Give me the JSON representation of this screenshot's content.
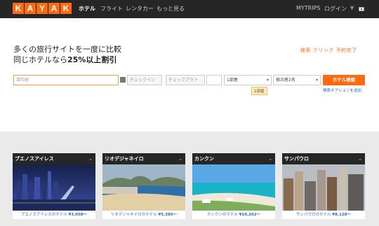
{
  "header": {
    "logo_letters": [
      "K",
      "A",
      "Y",
      "A",
      "K"
    ],
    "nav": [
      "ホテル",
      "フライト",
      "レンタカー",
      "もっと見る"
    ],
    "right": [
      "MYTRIPS",
      "ログイン",
      "¥"
    ]
  },
  "hero": {
    "line1": "多くの旅行サイトを一度に比較",
    "line2_prefix": "同じホテルなら",
    "line2_bold": "25%以上割引",
    "tagline": "検索 クリック 予約完了"
  },
  "search": {
    "destination_placeholder": "目的地",
    "checkin_placeholder": "チェックイン",
    "checkout_placeholder": "チェックアウト",
    "rooms_value": "1部屋",
    "guests_value": "宿泊者2名",
    "search_button": "ホテル検索",
    "tooltip": "1部屋",
    "options_link": "検索オプションを追加"
  },
  "cities": [
    {
      "name": "ブエノスアイレス",
      "link_prefix": "ブエノスアイレスのホテル",
      "price": "¥3,658〜"
    },
    {
      "name": "リオデジャネイロ",
      "link_prefix": "リオデジャネイロのホテル",
      "price": "¥5,385〜"
    },
    {
      "name": "カンクン",
      "link_prefix": "カンクンのホテル",
      "price": "¥10,262〜"
    },
    {
      "name": "サンパウロ",
      "link_prefix": "サンパウロのホテル",
      "price": "¥8,128〜"
    }
  ],
  "colors": {
    "brand_orange": "#ff690f",
    "topbar": "#262626",
    "link_blue": "#2a6ab5"
  }
}
